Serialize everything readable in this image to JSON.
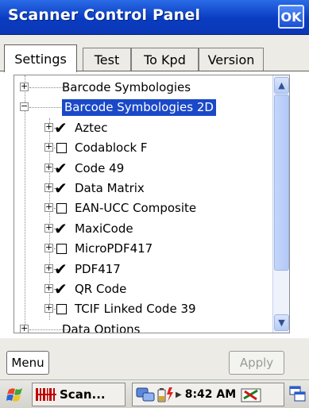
{
  "window": {
    "title": "Scanner Control Panel",
    "ok_label": "OK"
  },
  "tabs": [
    {
      "label": "Settings",
      "active": true
    },
    {
      "label": "Test",
      "active": false
    },
    {
      "label": "To Kpd",
      "active": false
    },
    {
      "label": "Version",
      "active": false
    }
  ],
  "tree": {
    "items": [
      {
        "label": "Barcode Symbologies",
        "level": 0,
        "expanded": false,
        "checkbox": null,
        "selected": false
      },
      {
        "label": "Barcode Symbologies 2D",
        "level": 0,
        "expanded": true,
        "checkbox": null,
        "selected": true
      },
      {
        "label": "Aztec",
        "level": 1,
        "expanded": false,
        "checkbox": true,
        "selected": false
      },
      {
        "label": "Codablock F",
        "level": 1,
        "expanded": false,
        "checkbox": false,
        "selected": false
      },
      {
        "label": "Code 49",
        "level": 1,
        "expanded": false,
        "checkbox": true,
        "selected": false
      },
      {
        "label": "Data Matrix",
        "level": 1,
        "expanded": false,
        "checkbox": true,
        "selected": false
      },
      {
        "label": "EAN-UCC Composite",
        "level": 1,
        "expanded": false,
        "checkbox": false,
        "selected": false
      },
      {
        "label": "MaxiCode",
        "level": 1,
        "expanded": false,
        "checkbox": true,
        "selected": false
      },
      {
        "label": "MicroPDF417",
        "level": 1,
        "expanded": false,
        "checkbox": false,
        "selected": false
      },
      {
        "label": "PDF417",
        "level": 1,
        "expanded": false,
        "checkbox": true,
        "selected": false
      },
      {
        "label": "QR Code",
        "level": 1,
        "expanded": false,
        "checkbox": true,
        "selected": false
      },
      {
        "label": "TCIF Linked Code 39",
        "level": 1,
        "expanded": false,
        "checkbox": false,
        "selected": false
      },
      {
        "label": "Data Options",
        "level": 0,
        "expanded": false,
        "checkbox": null,
        "selected": false
      }
    ]
  },
  "buttons": {
    "menu_label": "Menu",
    "apply_label": "Apply"
  },
  "taskbar": {
    "task_label": "Scan...",
    "clock": "8:42 AM"
  },
  "colors": {
    "titlebar": "#0a3cc2",
    "selection": "#1a49c8",
    "scrollbar": "#b2c8f6"
  }
}
